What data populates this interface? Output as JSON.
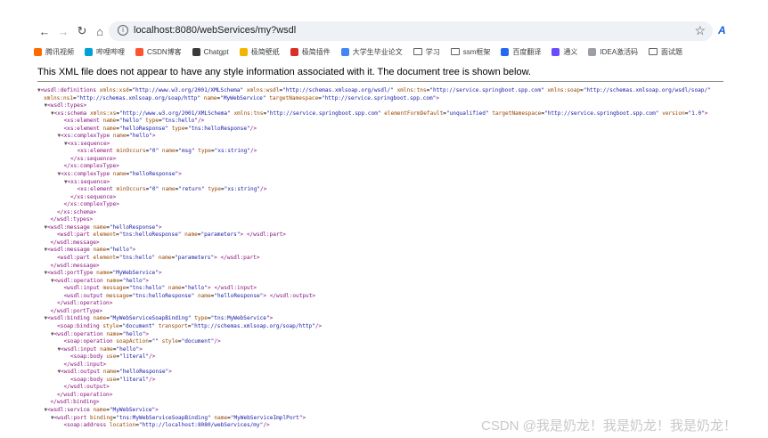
{
  "browser": {
    "url": "localhost:8080/webServices/my?wsdl",
    "bookmarks": [
      {
        "label": "腾讯视频",
        "color": "#ff6a00",
        "kind": "icon"
      },
      {
        "label": "哔哩哔哩",
        "color": "#00a1d6",
        "kind": "icon"
      },
      {
        "label": "CSDN博客",
        "color": "#fc5531",
        "kind": "icon"
      },
      {
        "label": "Chatgpt",
        "color": "#3a3a3a",
        "kind": "icon"
      },
      {
        "label": "极简壁纸",
        "color": "#f5b400",
        "kind": "icon"
      },
      {
        "label": "极简插件",
        "color": "#d93025",
        "kind": "icon"
      },
      {
        "label": "大学生毕业论文",
        "color": "#4285f4",
        "kind": "icon"
      },
      {
        "label": "学习",
        "color": "#5f6368",
        "kind": "folder"
      },
      {
        "label": "ssm框架",
        "color": "#5f6368",
        "kind": "folder"
      },
      {
        "label": "百度翻译",
        "color": "#2468f2",
        "kind": "icon"
      },
      {
        "label": "通义",
        "color": "#6a4cff",
        "kind": "icon"
      },
      {
        "label": "IDEA激活码",
        "color": "#9aa0a6",
        "kind": "icon"
      },
      {
        "label": "面试题",
        "color": "#5f6368",
        "kind": "folder"
      }
    ]
  },
  "info_message": "This XML file does not appear to have any style information associated with it. The document tree is shown below.",
  "xml_lines": [
    {
      "indent": 0,
      "tri": true,
      "text": "<wsdl:definitions xmlns:xsd=\"http://www.w3.org/2001/XMLSchema\" xmlns:wsdl=\"http://schemas.xmlsoap.org/wsdl/\" xmlns:tns=\"http://service.springboot.spp.com\" xmlns:soap=\"http://schemas.xmlsoap.org/wsdl/soap/\""
    },
    {
      "indent": 0,
      "tri": false,
      "text": "xmlns:ns1=\"http://schemas.xmlsoap.org/soap/http\" name=\"MyWebService\" targetNamespace=\"http://service.springboot.spp.com\">"
    },
    {
      "indent": 1,
      "tri": true,
      "text": "<wsdl:types>"
    },
    {
      "indent": 2,
      "tri": true,
      "text": "<xs:schema xmlns:xs=\"http://www.w3.org/2001/XMLSchema\" xmlns:tns=\"http://service.springboot.spp.com\" elementFormDefault=\"unqualified\" targetNamespace=\"http://service.springboot.spp.com\" version=\"1.0\">"
    },
    {
      "indent": 3,
      "tri": false,
      "text": "<xs:element name=\"hello\" type=\"tns:hello\"/>"
    },
    {
      "indent": 3,
      "tri": false,
      "text": "<xs:element name=\"helloResponse\" type=\"tns:helloResponse\"/>"
    },
    {
      "indent": 3,
      "tri": true,
      "text": "<xs:complexType name=\"hello\">"
    },
    {
      "indent": 4,
      "tri": true,
      "text": "<xs:sequence>"
    },
    {
      "indent": 5,
      "tri": false,
      "text": "<xs:element minOccurs=\"0\" name=\"msg\" type=\"xs:string\"/>"
    },
    {
      "indent": 4,
      "tri": false,
      "text": "</xs:sequence>"
    },
    {
      "indent": 3,
      "tri": false,
      "text": "</xs:complexType>"
    },
    {
      "indent": 3,
      "tri": true,
      "text": "<xs:complexType name=\"helloResponse\">"
    },
    {
      "indent": 4,
      "tri": true,
      "text": "<xs:sequence>"
    },
    {
      "indent": 5,
      "tri": false,
      "text": "<xs:element minOccurs=\"0\" name=\"return\" type=\"xs:string\"/>"
    },
    {
      "indent": 4,
      "tri": false,
      "text": "</xs:sequence>"
    },
    {
      "indent": 3,
      "tri": false,
      "text": "</xs:complexType>"
    },
    {
      "indent": 2,
      "tri": false,
      "text": "</xs:schema>"
    },
    {
      "indent": 1,
      "tri": false,
      "text": "</wsdl:types>"
    },
    {
      "indent": 1,
      "tri": true,
      "text": "<wsdl:message name=\"helloResponse\">"
    },
    {
      "indent": 2,
      "tri": false,
      "text": "<wsdl:part element=\"tns:helloResponse\" name=\"parameters\"> </wsdl:part>"
    },
    {
      "indent": 1,
      "tri": false,
      "text": "</wsdl:message>"
    },
    {
      "indent": 1,
      "tri": true,
      "text": "<wsdl:message name=\"hello\">"
    },
    {
      "indent": 2,
      "tri": false,
      "text": "<wsdl:part element=\"tns:hello\" name=\"parameters\"> </wsdl:part>"
    },
    {
      "indent": 1,
      "tri": false,
      "text": "</wsdl:message>"
    },
    {
      "indent": 1,
      "tri": true,
      "text": "<wsdl:portType name=\"MyWebService\">"
    },
    {
      "indent": 2,
      "tri": true,
      "text": "<wsdl:operation name=\"hello\">"
    },
    {
      "indent": 3,
      "tri": false,
      "text": "<wsdl:input message=\"tns:hello\" name=\"hello\"> </wsdl:input>"
    },
    {
      "indent": 3,
      "tri": false,
      "text": "<wsdl:output message=\"tns:helloResponse\" name=\"helloResponse\"> </wsdl:output>"
    },
    {
      "indent": 2,
      "tri": false,
      "text": "</wsdl:operation>"
    },
    {
      "indent": 1,
      "tri": false,
      "text": "</wsdl:portType>"
    },
    {
      "indent": 1,
      "tri": true,
      "text": "<wsdl:binding name=\"MyWebServiceSoapBinding\" type=\"tns:MyWebService\">"
    },
    {
      "indent": 2,
      "tri": false,
      "text": "<soap:binding style=\"document\" transport=\"http://schemas.xmlsoap.org/soap/http\"/>"
    },
    {
      "indent": 2,
      "tri": true,
      "text": "<wsdl:operation name=\"hello\">"
    },
    {
      "indent": 3,
      "tri": false,
      "text": "<soap:operation soapAction=\"\" style=\"document\"/>"
    },
    {
      "indent": 3,
      "tri": true,
      "text": "<wsdl:input name=\"hello\">"
    },
    {
      "indent": 4,
      "tri": false,
      "text": "<soap:body use=\"literal\"/>"
    },
    {
      "indent": 3,
      "tri": false,
      "text": "</wsdl:input>"
    },
    {
      "indent": 3,
      "tri": true,
      "text": "<wsdl:output name=\"helloResponse\">"
    },
    {
      "indent": 4,
      "tri": false,
      "text": "<soap:body use=\"literal\"/>"
    },
    {
      "indent": 3,
      "tri": false,
      "text": "</wsdl:output>"
    },
    {
      "indent": 2,
      "tri": false,
      "text": "</wsdl:operation>"
    },
    {
      "indent": 1,
      "tri": false,
      "text": "</wsdl:binding>"
    },
    {
      "indent": 1,
      "tri": true,
      "text": "<wsdl:service name=\"MyWebService\">"
    },
    {
      "indent": 2,
      "tri": true,
      "text": "<wsdl:port binding=\"tns:MyWebServiceSoapBinding\" name=\"MyWebServiceImplPort\">"
    },
    {
      "indent": 3,
      "tri": false,
      "text": "<soap:address location=\"http://localhost:8080/webServices/my\"/>"
    }
  ],
  "watermark": "CSDN @我是奶龙！我是奶龙！我是奶龙！"
}
